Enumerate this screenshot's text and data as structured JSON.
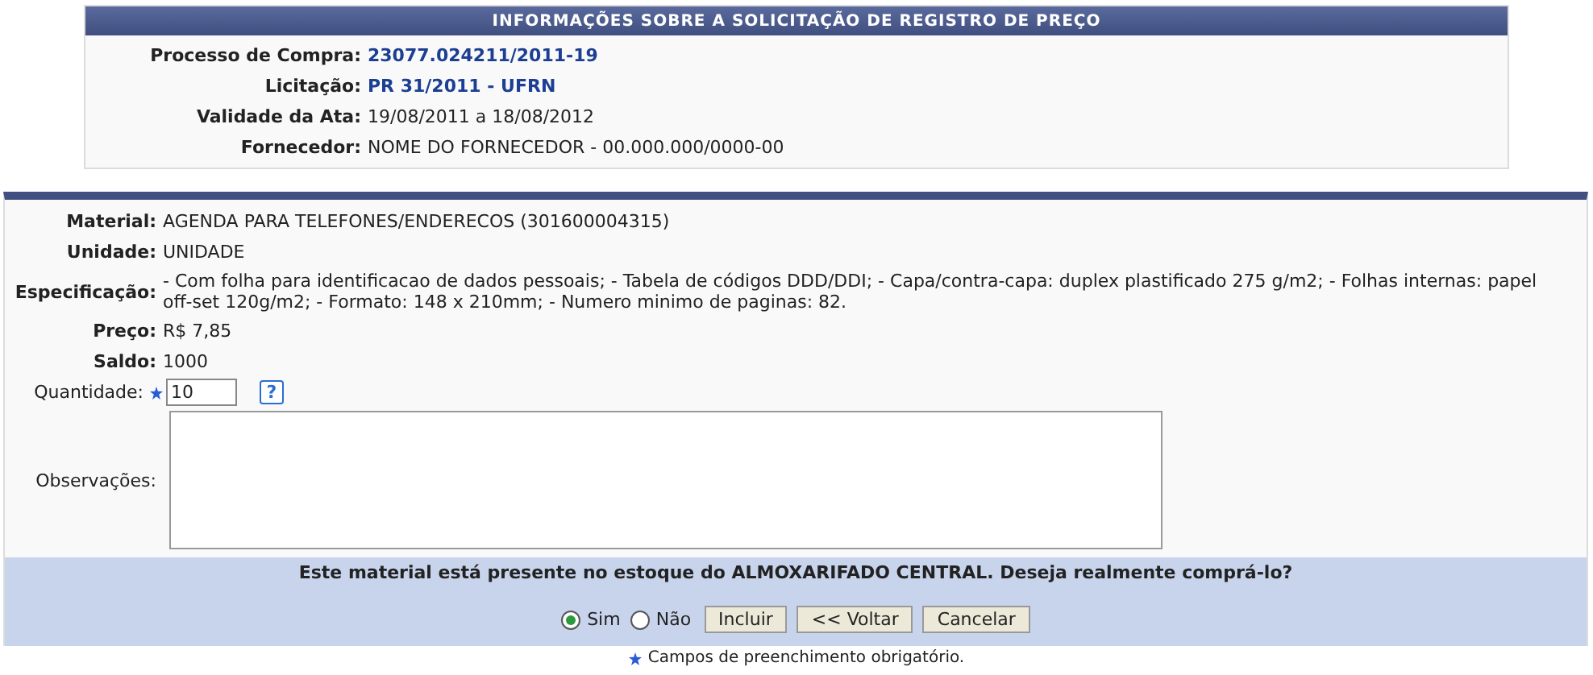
{
  "info_panel": {
    "title": "INFORMAÇÕES SOBRE A SOLICITAÇÃO DE REGISTRO DE PREÇO",
    "rows": [
      {
        "label": "Processo de Compra:",
        "value": "23077.024211/2011-19",
        "kind": "link"
      },
      {
        "label": "Licitação:",
        "value": "PR 31/2011 - UFRN",
        "kind": "link"
      },
      {
        "label": "Validade da Ata:",
        "value": "19/08/2011 a 18/08/2012",
        "kind": "text"
      },
      {
        "label": "Fornecedor:",
        "value": "NOME DO FORNECEDOR - 00.000.000/0000-00",
        "kind": "text"
      }
    ]
  },
  "form": {
    "details": [
      {
        "label": "Material:",
        "value": "AGENDA PARA TELEFONES/ENDERECOS (301600004315)"
      },
      {
        "label": "Unidade:",
        "value": "UNIDADE"
      },
      {
        "label": "Especificação:",
        "value": "- Com folha para identificacao de dados pessoais; - Tabela de códigos DDD/DDI; - Capa/contra-capa: duplex plastificado 275 g/m2; - Folhas internas: papel off-set 120g/m2; - Formato: 148 x 210mm; - Numero minimo de paginas: 82."
      },
      {
        "label": "Preço:",
        "value": "R$ 7,85"
      },
      {
        "label": "Saldo:",
        "value": "1000"
      }
    ],
    "quantity": {
      "label": "Quantidade:",
      "value": "10",
      "required": true,
      "help": "?"
    },
    "observations": {
      "label": "Observações:"
    },
    "footer": {
      "question": "Este material está presente no estoque do ALMOXARIFADO CENTRAL. Deseja realmente comprá-lo?",
      "options": [
        {
          "label": "Sim",
          "selected": true
        },
        {
          "label": "Não",
          "selected": false
        }
      ],
      "buttons": [
        "Incluir",
        "<< Voltar",
        "Cancelar"
      ]
    },
    "required_note": "Campos de preenchimento obrigatório."
  }
}
